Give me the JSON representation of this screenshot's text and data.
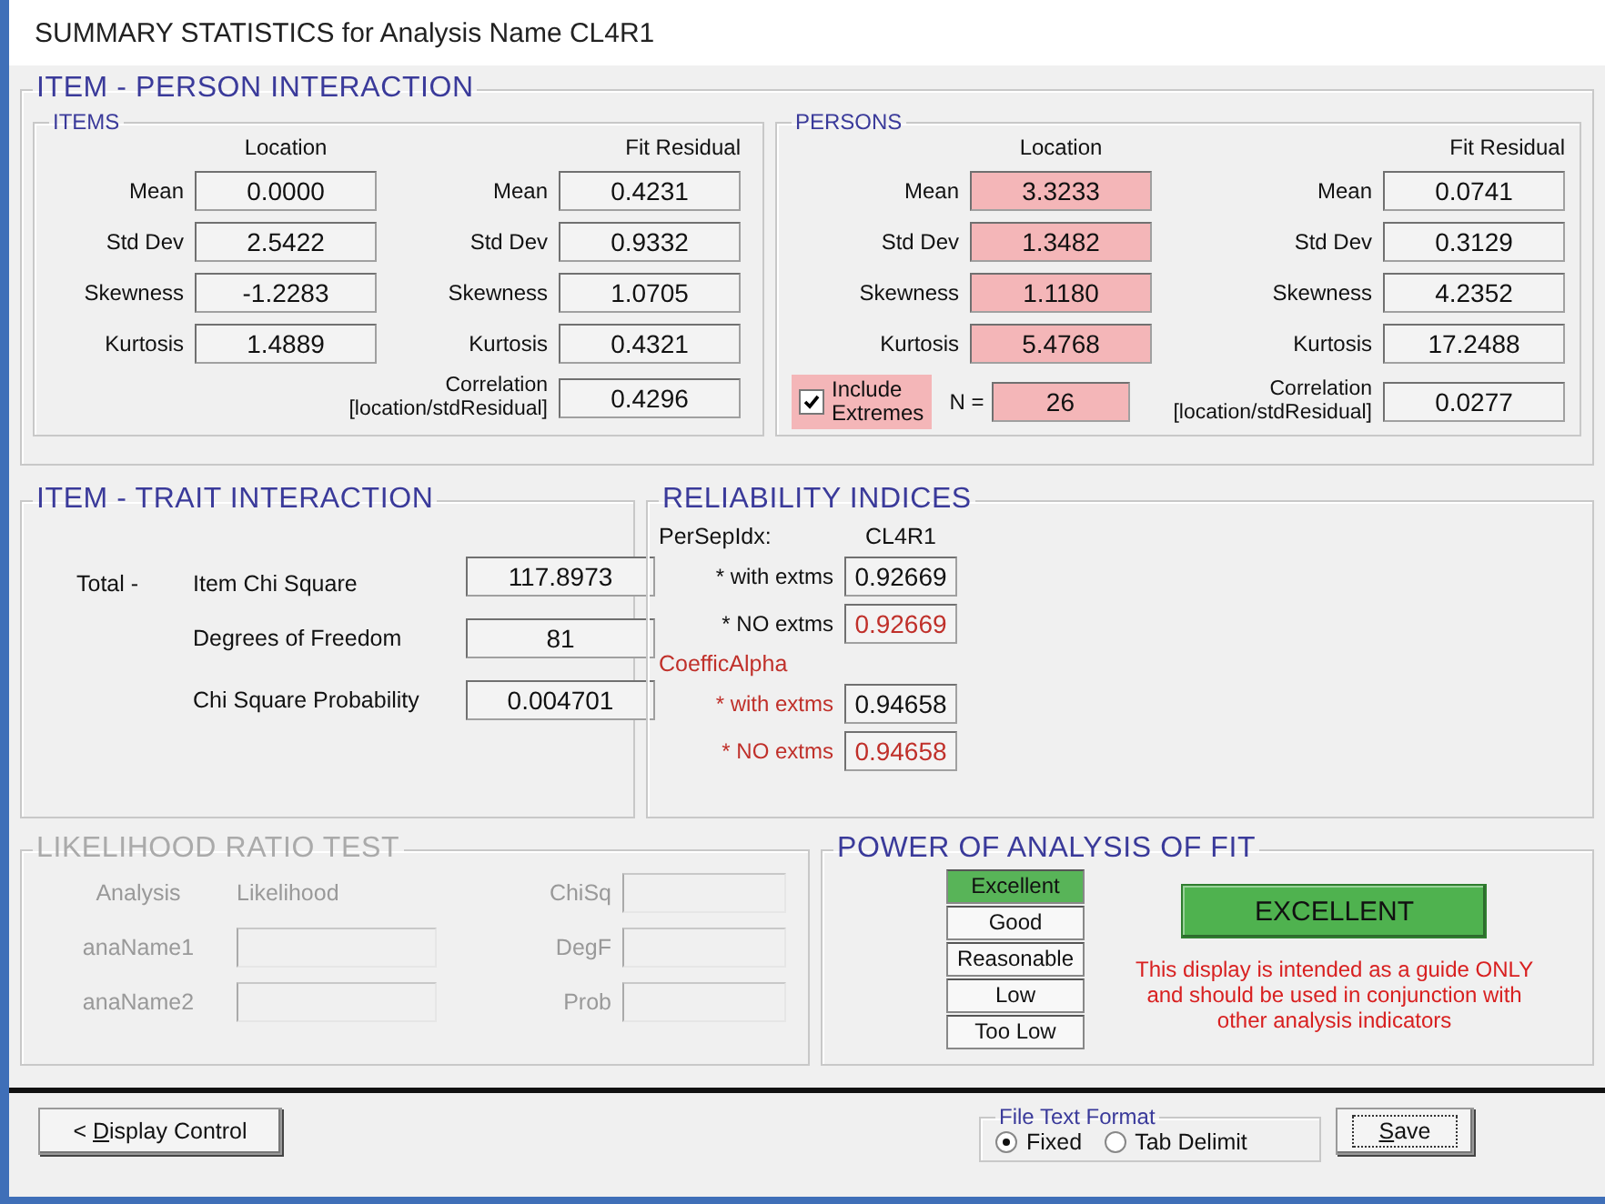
{
  "window": {
    "title": "SUMMARY STATISTICS for Analysis Name CL4R1"
  },
  "item_person_interaction": {
    "title": "ITEM - PERSON  INTERACTION",
    "items": {
      "title": "ITEMS",
      "location_header": "Location",
      "fit_header": "Fit Residual",
      "location_rows": [
        {
          "label": "Mean",
          "value": "0.0000",
          "highlighted": false
        },
        {
          "label": "Std Dev",
          "value": "2.5422",
          "highlighted": false
        },
        {
          "label": "Skewness",
          "value": "-1.2283",
          "highlighted": false
        },
        {
          "label": "Kurtosis",
          "value": "1.4889",
          "highlighted": false
        }
      ],
      "fit_rows": [
        {
          "label": "Mean",
          "value": "0.4231"
        },
        {
          "label": "Std Dev",
          "value": "0.9332"
        },
        {
          "label": "Skewness",
          "value": "1.0705"
        },
        {
          "label": "Kurtosis",
          "value": "0.4321"
        }
      ],
      "correlation": {
        "label_1": "Correlation",
        "label_2": "[location/stdResidual]",
        "value": "0.4296"
      }
    },
    "persons": {
      "title": "PERSONS",
      "location_header": "Location",
      "fit_header": "Fit Residual",
      "location_rows": [
        {
          "label": "Mean",
          "value": "3.3233",
          "highlighted": true
        },
        {
          "label": "Std Dev",
          "value": "1.3482",
          "highlighted": true
        },
        {
          "label": "Skewness",
          "value": "1.1180",
          "highlighted": true
        },
        {
          "label": "Kurtosis",
          "value": "5.4768",
          "highlighted": true
        }
      ],
      "fit_rows": [
        {
          "label": "Mean",
          "value": "0.0741"
        },
        {
          "label": "Std Dev",
          "value": "0.3129"
        },
        {
          "label": "Skewness",
          "value": "4.2352"
        },
        {
          "label": "Kurtosis",
          "value": "17.2488"
        }
      ],
      "include_extremes": {
        "label_1": "Include",
        "label_2": "Extremes",
        "checked": true
      },
      "n": {
        "label": "N =",
        "value": "26"
      },
      "correlation": {
        "label_1": "Correlation",
        "label_2": "[location/stdResidual]",
        "value": "0.0277"
      }
    }
  },
  "item_trait_interaction": {
    "title": "ITEM - TRAIT  INTERACTION",
    "prefix": "Total -",
    "rows": [
      {
        "label": "Item Chi Square",
        "value": "117.8973"
      },
      {
        "label": "Degrees of Freedom",
        "value": "81"
      },
      {
        "label": "Chi Square Probability",
        "value": "0.004701"
      }
    ]
  },
  "reliability_indices": {
    "title": "RELIABILITY  INDICES",
    "column_header": "CL4R1",
    "groups": [
      {
        "heading": "PerSepIdx:",
        "heading_red": false,
        "rows": [
          {
            "label": "* with extms",
            "value": "0.92669",
            "label_red": false,
            "value_red": false
          },
          {
            "label": "* NO extms",
            "value": "0.92669",
            "label_red": false,
            "value_red": true
          }
        ]
      },
      {
        "heading": "CoefficAlpha",
        "heading_red": true,
        "rows": [
          {
            "label": "* with extms",
            "value": "0.94658",
            "label_red": true,
            "value_red": false
          },
          {
            "label": "* NO extms",
            "value": "0.94658",
            "label_red": true,
            "value_red": true
          }
        ]
      }
    ]
  },
  "likelihood_ratio_test": {
    "title": "LIKELIHOOD  RATIO  TEST",
    "disabled": true,
    "headers": [
      "Analysis",
      "Likelihood"
    ],
    "rows": [
      {
        "label": "anaName1"
      },
      {
        "label": "anaName2"
      }
    ],
    "stats": [
      {
        "label": "ChiSq"
      },
      {
        "label": "DegF"
      },
      {
        "label": "Prob"
      }
    ]
  },
  "power_of_analysis_of_fit": {
    "title": "POWER  OF  ANALYSIS  OF  FIT",
    "levels": [
      {
        "label": "Excellent",
        "selected": true
      },
      {
        "label": "Good",
        "selected": false
      },
      {
        "label": "Reasonable",
        "selected": false
      },
      {
        "label": "Low",
        "selected": false
      },
      {
        "label": "Too Low",
        "selected": false
      }
    ],
    "result": "EXCELLENT",
    "note_lines": [
      "This display is intended as a guide ONLY",
      "and should be used in conjunction with",
      "other analysis indicators"
    ]
  },
  "footer": {
    "display_control": {
      "prefix": "< ",
      "mnemonic": "D",
      "rest": "isplay Control"
    },
    "file_text_format": {
      "title": "File Text Format",
      "options": [
        {
          "label": "Fixed",
          "selected": true
        },
        {
          "label": "Tab Delimit",
          "selected": false
        }
      ]
    },
    "save": {
      "mnemonic": "S",
      "rest": "ave"
    }
  }
}
